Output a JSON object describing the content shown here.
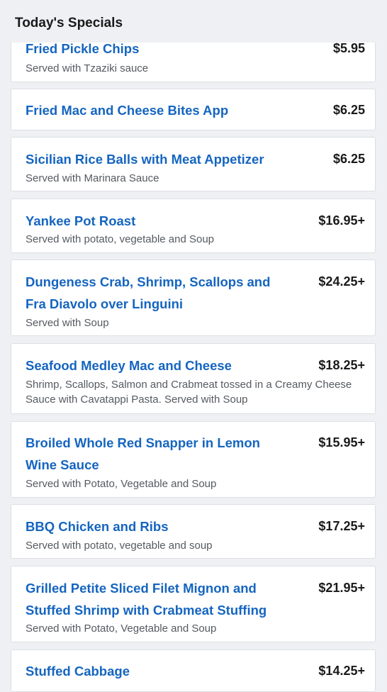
{
  "header": {
    "title": "Today's Specials"
  },
  "items": [
    {
      "name": "Fried Pickle Chips",
      "price": "$5.95",
      "desc": "Served with Tzaziki sauce"
    },
    {
      "name": "Fried Mac and Cheese Bites App",
      "price": "$6.25",
      "desc": ""
    },
    {
      "name": "Sicilian Rice Balls with Meat Appetizer",
      "price": "$6.25",
      "desc": "Served with Marinara Sauce"
    },
    {
      "name": "Yankee Pot Roast",
      "price": "$16.95+",
      "desc": "Served with potato, vegetable and Soup"
    },
    {
      "name": "Dungeness Crab, Shrimp, Scallops and Fra Diavolo over Linguini",
      "price": "$24.25+",
      "desc": "Served with Soup"
    },
    {
      "name": "Seafood Medley Mac and Cheese",
      "price": "$18.25+",
      "desc": "Shrimp, Scallops, Salmon and Crabmeat tossed in a Creamy Cheese Sauce with Cavatappi Pasta. Served with Soup"
    },
    {
      "name": "Broiled Whole Red Snapper in Lemon Wine Sauce",
      "price": "$15.95+",
      "desc": "Served with Potato, Vegetable and Soup"
    },
    {
      "name": "BBQ Chicken and Ribs",
      "price": "$17.25+",
      "desc": "Served with potato, vegetable and soup"
    },
    {
      "name": "Grilled Petite Sliced Filet Mignon and Stuffed Shrimp with Crabmeat Stuffing",
      "price": "$21.95+",
      "desc": "Served with Potato, Vegetable and Soup"
    },
    {
      "name": "Stuffed Cabbage",
      "price": "$14.25+",
      "desc": ""
    }
  ]
}
